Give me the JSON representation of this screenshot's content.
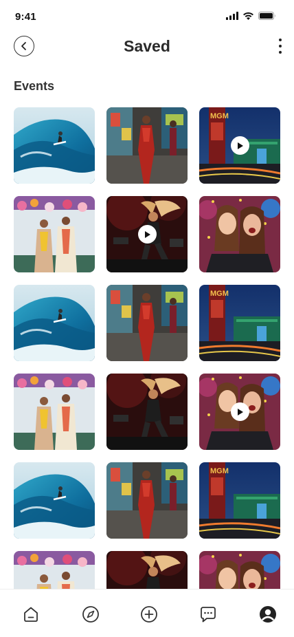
{
  "status_bar": {
    "time": "9:41",
    "icons": [
      "cellular-signal-icon",
      "wifi-icon",
      "battery-icon"
    ]
  },
  "header": {
    "title": "Saved",
    "back_icon": "back-chevron-icon",
    "more_icon": "more-vertical-icon"
  },
  "section": {
    "title": "Events"
  },
  "grid": {
    "items": [
      {
        "scene": "surfer",
        "video": false
      },
      {
        "scene": "runway-model",
        "video": false
      },
      {
        "scene": "mgm-casino",
        "video": true
      },
      {
        "scene": "wedding-couple",
        "video": false
      },
      {
        "scene": "concert-dancer",
        "video": true
      },
      {
        "scene": "party-friends",
        "video": false
      },
      {
        "scene": "surfer",
        "video": false
      },
      {
        "scene": "runway-model",
        "video": false
      },
      {
        "scene": "mgm-casino",
        "video": false
      },
      {
        "scene": "wedding-couple",
        "video": false
      },
      {
        "scene": "concert-dancer",
        "video": false
      },
      {
        "scene": "party-friends",
        "video": true
      },
      {
        "scene": "surfer",
        "video": false
      },
      {
        "scene": "runway-model",
        "video": false
      },
      {
        "scene": "mgm-casino",
        "video": false
      },
      {
        "scene": "wedding-couple",
        "video": false
      },
      {
        "scene": "concert-dancer",
        "video": false
      },
      {
        "scene": "party-friends",
        "video": false
      }
    ],
    "sign_text": "MGM"
  },
  "bottom_nav": {
    "items": [
      {
        "icon": "home-icon"
      },
      {
        "icon": "explore-compass-icon"
      },
      {
        "icon": "add-post-icon"
      },
      {
        "icon": "messages-icon"
      },
      {
        "icon": "profile-icon"
      }
    ]
  },
  "colors": {
    "text": "#222222",
    "background": "#ffffff"
  }
}
